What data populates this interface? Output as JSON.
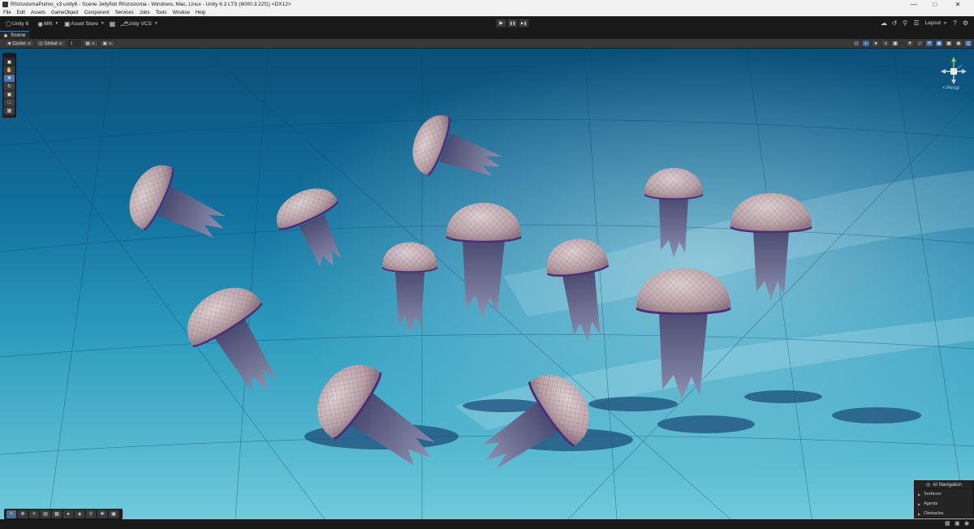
{
  "window": {
    "title": "RhizostomaPulmo_v3 unity6 - Scene Jellyfish Rhizostoma - Windows, Mac, Linux - Unity 6.3 LTS (6000.3.22f1) <DX12>",
    "controls": {
      "minimize": "—",
      "maximize": "□",
      "close": "✕"
    }
  },
  "menu": [
    "File",
    "Edit",
    "Assets",
    "GameObject",
    "Component",
    "Services",
    "Jobs",
    "Tools",
    "Window",
    "Help"
  ],
  "toolbar": {
    "unity_label": "Unity 6",
    "account_label": "MN",
    "asset_store_label": "Asset Store",
    "vcs_label": "Unity VCS",
    "layout_label": "Layout",
    "play_icon": "▶",
    "pause_icon": "❚❚",
    "step_icon": "▶❚"
  },
  "scene_tab": {
    "label": "Scene"
  },
  "scene_toolbar": {
    "pivot_label": "Center",
    "space_label": "Global",
    "grid_value": "1"
  },
  "gizmo": {
    "projection_label": "< Persp"
  },
  "ai_navigation": {
    "title": "AI Navigation",
    "items": [
      "Surfaces",
      "Agents",
      "Obstacles"
    ]
  },
  "colors": {
    "accent": "#4a78a8",
    "water_top": "#0d5a86",
    "water_floor": "#5ec3d6",
    "bell": "#c9b4b6",
    "tentacles": "#5a5f86"
  }
}
